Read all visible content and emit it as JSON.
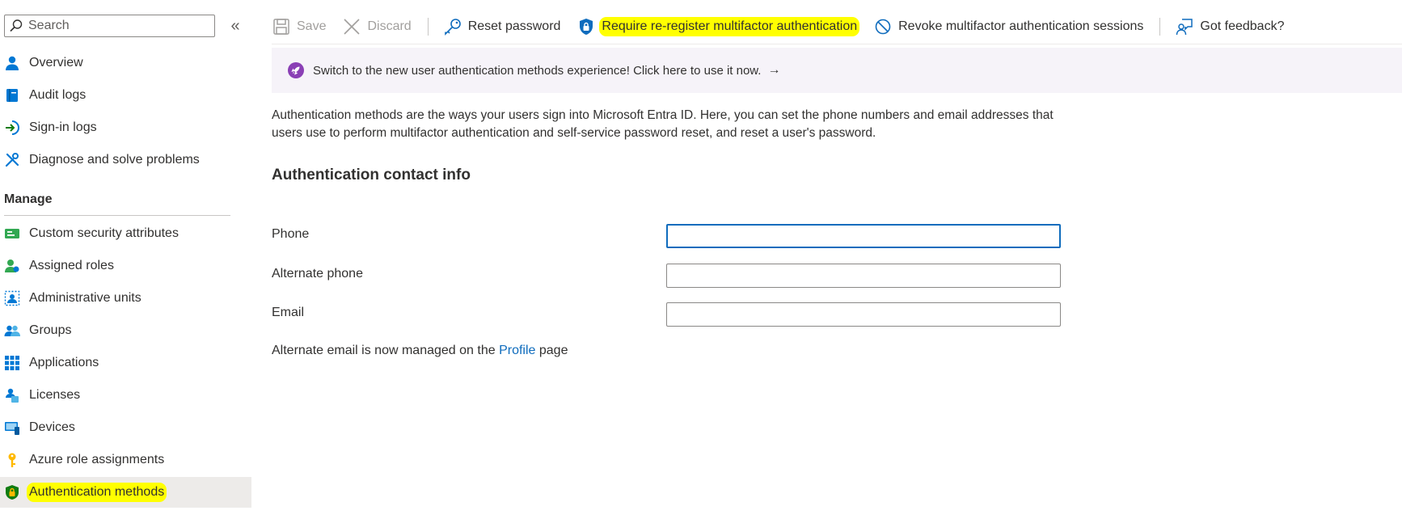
{
  "sidebar": {
    "search_placeholder": "Search",
    "collapse_glyph": "«",
    "items_top": [
      {
        "label": "Overview",
        "icon": "person-icon"
      },
      {
        "label": "Audit logs",
        "icon": "book-icon"
      },
      {
        "label": "Sign-in logs",
        "icon": "sign-in-icon"
      },
      {
        "label": "Diagnose and solve problems",
        "icon": "wrench-icon"
      }
    ],
    "section_label": "Manage",
    "items_manage": [
      {
        "label": "Custom security attributes",
        "icon": "tag-card-icon"
      },
      {
        "label": "Assigned roles",
        "icon": "person-role-icon"
      },
      {
        "label": "Administrative units",
        "icon": "admin-unit-icon"
      },
      {
        "label": "Groups",
        "icon": "people-icon"
      },
      {
        "label": "Applications",
        "icon": "grid-icon"
      },
      {
        "label": "Licenses",
        "icon": "license-icon"
      },
      {
        "label": "Devices",
        "icon": "device-icon"
      },
      {
        "label": "Azure role assignments",
        "icon": "key-icon"
      },
      {
        "label": "Authentication methods",
        "icon": "shield-icon",
        "selected": true,
        "highlighted": true
      }
    ]
  },
  "toolbar": {
    "save_label": "Save",
    "discard_label": "Discard",
    "reset_password_label": "Reset password",
    "require_reregister_label": "Require re-register multifactor authentication",
    "revoke_sessions_label": "Revoke multifactor authentication sessions",
    "feedback_label": "Got feedback?"
  },
  "banner": {
    "text": "Switch to the new user authentication methods experience! Click here to use it now.",
    "arrow": "→"
  },
  "main": {
    "description": "Authentication methods are the ways your users sign into Microsoft Entra ID. Here, you can set the phone numbers and email addresses that users use to perform multifactor authentication and self-service password reset, and reset a user's password.",
    "heading": "Authentication contact info",
    "fields": {
      "phone_label": "Phone",
      "phone_value": "",
      "alt_phone_label": "Alternate phone",
      "alt_phone_value": "",
      "email_label": "Email",
      "email_value": ""
    },
    "note_prefix": "Alternate email is now managed on the ",
    "note_link": "Profile",
    "note_suffix": " page"
  },
  "colors": {
    "accent": "#0f6cbd",
    "highlight": "#ffff00",
    "banner_bg": "#f6f3f9",
    "selected_bg": "#edebe9"
  }
}
